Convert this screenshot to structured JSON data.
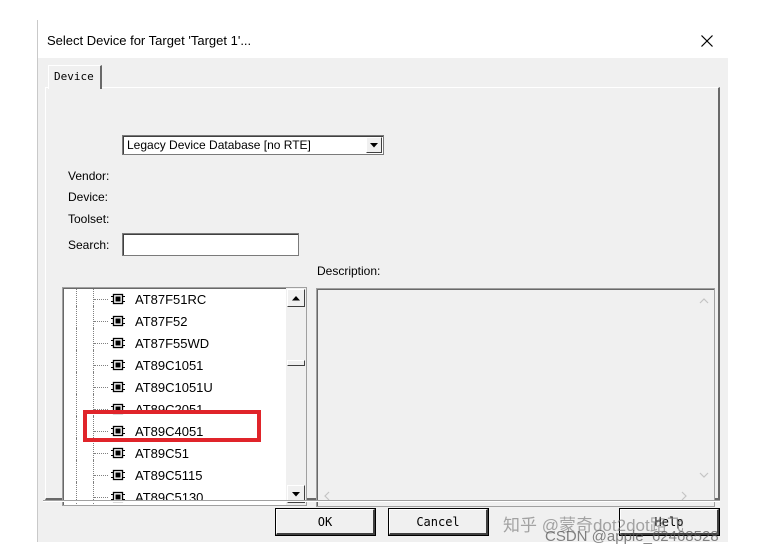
{
  "window": {
    "title": "Select Device for Target 'Target 1'..."
  },
  "tabs": [
    {
      "label": "Device"
    }
  ],
  "database": {
    "selected": "Legacy Device Database [no RTE]"
  },
  "labels": {
    "vendor": "Vendor:",
    "device": "Device:",
    "toolset": "Toolset:",
    "search": "Search:",
    "description": "Description:"
  },
  "search": {
    "value": "",
    "placeholder": ""
  },
  "device_tree": {
    "items": [
      {
        "label": "AT87F51RC"
      },
      {
        "label": "AT87F52"
      },
      {
        "label": "AT87F55WD"
      },
      {
        "label": "AT89C1051"
      },
      {
        "label": "AT89C1051U"
      },
      {
        "label": "AT89C2051"
      },
      {
        "label": "AT89C4051"
      },
      {
        "label": "AT89C51",
        "selected": true
      },
      {
        "label": "AT89C5115"
      },
      {
        "label": "AT89C5130"
      }
    ]
  },
  "buttons": {
    "ok": "OK",
    "cancel": "Cancel",
    "help": "Help"
  },
  "watermark": {
    "line1": "知乎 @蒙奇dot2dot路飞",
    "line2": "CSDN @apple_62468528"
  },
  "icons": {
    "close": "close-icon",
    "dropdown": "chevron-down-icon",
    "chip": "chip-icon",
    "scroll_up": "arrow-up-icon",
    "scroll_down": "arrow-down-icon"
  },
  "colors": {
    "highlight": "#e0242a",
    "dialog_bg": "#f0f0f0"
  }
}
